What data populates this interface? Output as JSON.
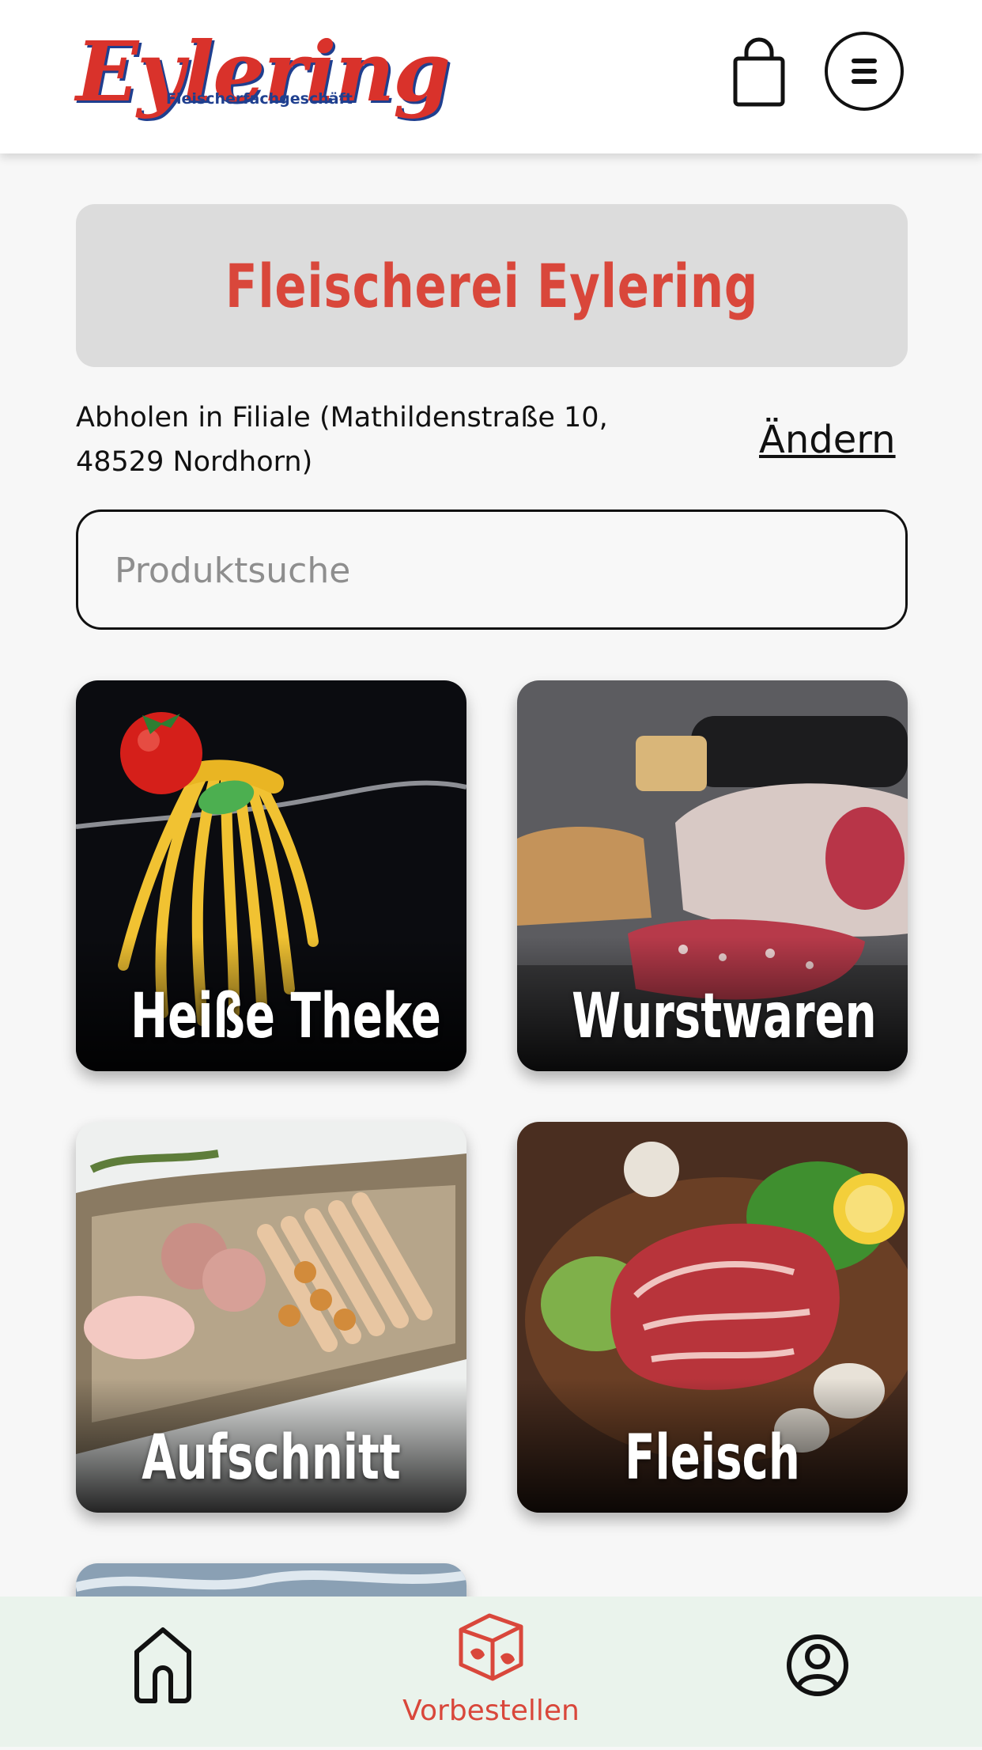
{
  "header": {
    "logo_text": "Eylering",
    "logo_subtitle": "Fleischerfachgeschäft",
    "cart_icon": "shopping-bag-icon",
    "menu_icon": "hamburger-menu-icon"
  },
  "store": {
    "title": "Fleischerei Eylering",
    "pickup_line1": "Abholen in Filiale (Mathildenstraße 10,",
    "pickup_line2": "48529 Nordhorn)",
    "change_label": "Ändern"
  },
  "search": {
    "placeholder": "Produktsuche",
    "value": ""
  },
  "categories": [
    {
      "label": "Heiße Theke",
      "image": "spaghetti-tomato-fork"
    },
    {
      "label": "Wurstwaren",
      "image": "salami-bread-wine"
    },
    {
      "label": "Aufschnitt",
      "image": "cold-cuts-board"
    },
    {
      "label": "Fleisch",
      "image": "raw-steak-board"
    },
    {
      "label": "",
      "image": "partial-tile"
    }
  ],
  "bottom_nav": {
    "home_icon": "home-icon",
    "order_label": "Vorbestellen",
    "order_icon": "box-icon",
    "account_icon": "user-icon",
    "active_color": "#d9473b"
  },
  "colors": {
    "brand_red": "#d9322b",
    "brand_blue": "#1f3f8f",
    "banner_bg": "#dcdcdc",
    "nav_bg": "#eaf3ec"
  }
}
